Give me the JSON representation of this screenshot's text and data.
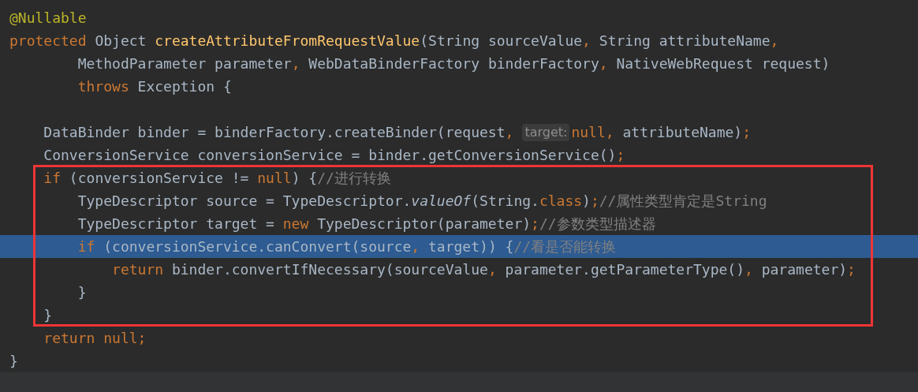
{
  "editor": {
    "sections": [
      {
        "boxed": false,
        "lines": [
          {
            "selected": false,
            "tokens": [
              {
                "kind": "annotation",
                "text": "@Nullable"
              }
            ]
          },
          {
            "selected": false,
            "tokens": [
              {
                "kind": "keyword",
                "text": "protected"
              },
              {
                "kind": "plain",
                "text": " Object "
              },
              {
                "kind": "declaration",
                "text": "createAttributeFromRequestValue"
              },
              {
                "kind": "plain",
                "text": "(String sourceValue"
              },
              {
                "kind": "keyword",
                "text": ","
              },
              {
                "kind": "plain",
                "text": " String attributeName"
              },
              {
                "kind": "keyword",
                "text": ","
              }
            ]
          },
          {
            "selected": false,
            "tokens": [
              {
                "kind": "plain",
                "text": "        MethodParameter parameter"
              },
              {
                "kind": "keyword",
                "text": ","
              },
              {
                "kind": "plain",
                "text": " WebDataBinderFactory binderFactory"
              },
              {
                "kind": "keyword",
                "text": ","
              },
              {
                "kind": "plain",
                "text": " NativeWebRequest request)"
              }
            ]
          },
          {
            "selected": false,
            "tokens": [
              {
                "kind": "keyword",
                "text": "        throws"
              },
              {
                "kind": "plain",
                "text": " Exception {"
              }
            ]
          },
          {
            "selected": false
          },
          {
            "selected": false,
            "tokens": [
              {
                "kind": "plain",
                "text": "    DataBinder binder = binderFactory.createBinder(request"
              },
              {
                "kind": "keyword",
                "text": ","
              },
              {
                "kind": "hint",
                "text": "target:"
              },
              {
                "kind": "keyword",
                "text": "null"
              },
              {
                "kind": "keyword",
                "text": ","
              },
              {
                "kind": "plain",
                "text": " attributeName)"
              },
              {
                "kind": "keyword",
                "text": ";"
              }
            ]
          },
          {
            "selected": false,
            "tokens": [
              {
                "kind": "plain",
                "text": "    ConversionService conversionService = binder.getConversionService()"
              },
              {
                "kind": "keyword",
                "text": ";"
              }
            ]
          }
        ]
      },
      {
        "boxed": true,
        "lines": [
          {
            "selected": false,
            "tokens": [
              {
                "kind": "keyword",
                "text": "    if"
              },
              {
                "kind": "plain",
                "text": " (conversionService != "
              },
              {
                "kind": "keyword",
                "text": "null"
              },
              {
                "kind": "plain",
                "text": ") {"
              },
              {
                "kind": "comment",
                "text": "//进行转换"
              }
            ]
          },
          {
            "selected": false,
            "tokens": [
              {
                "kind": "plain",
                "text": "        TypeDescriptor source = TypeDescriptor."
              },
              {
                "kind": "static",
                "text": "valueOf"
              },
              {
                "kind": "plain",
                "text": "(String."
              },
              {
                "kind": "keyword",
                "text": "class"
              },
              {
                "kind": "plain",
                "text": ")"
              },
              {
                "kind": "keyword",
                "text": ";"
              },
              {
                "kind": "comment",
                "text": "//属性类型肯定是String"
              }
            ]
          },
          {
            "selected": false,
            "tokens": [
              {
                "kind": "plain",
                "text": "        TypeDescriptor target = "
              },
              {
                "kind": "keyword",
                "text": "new"
              },
              {
                "kind": "plain",
                "text": " TypeDescriptor(parameter)"
              },
              {
                "kind": "keyword",
                "text": ";"
              },
              {
                "kind": "comment",
                "text": "//参数类型描述器"
              }
            ]
          },
          {
            "selected": true,
            "tokens": [
              {
                "kind": "keyword",
                "text": "        if"
              },
              {
                "kind": "plain",
                "text": " (conversionService.canConvert(source"
              },
              {
                "kind": "keyword",
                "text": ","
              },
              {
                "kind": "plain",
                "text": " target)) {"
              },
              {
                "kind": "comment",
                "text": "//看是否能转换"
              }
            ]
          },
          {
            "selected": false,
            "tokens": [
              {
                "kind": "keyword",
                "text": "            return"
              },
              {
                "kind": "plain",
                "text": " binder.convertIfNecessary(sourceValue"
              },
              {
                "kind": "keyword",
                "text": ","
              },
              {
                "kind": "plain",
                "text": " parameter.getParameterType()"
              },
              {
                "kind": "keyword",
                "text": ","
              },
              {
                "kind": "plain",
                "text": " parameter)"
              },
              {
                "kind": "keyword",
                "text": ";"
              }
            ]
          },
          {
            "selected": false,
            "tokens": [
              {
                "kind": "plain",
                "text": "        }"
              }
            ]
          },
          {
            "selected": false,
            "tokens": [
              {
                "kind": "plain",
                "text": "    }"
              }
            ]
          }
        ]
      },
      {
        "boxed": false,
        "lines": [
          {
            "selected": false,
            "tokens": [
              {
                "kind": "keyword",
                "text": "    return null;"
              }
            ]
          },
          {
            "selected": false,
            "tokens": [
              {
                "kind": "plain",
                "text": "}"
              }
            ]
          }
        ]
      }
    ]
  }
}
